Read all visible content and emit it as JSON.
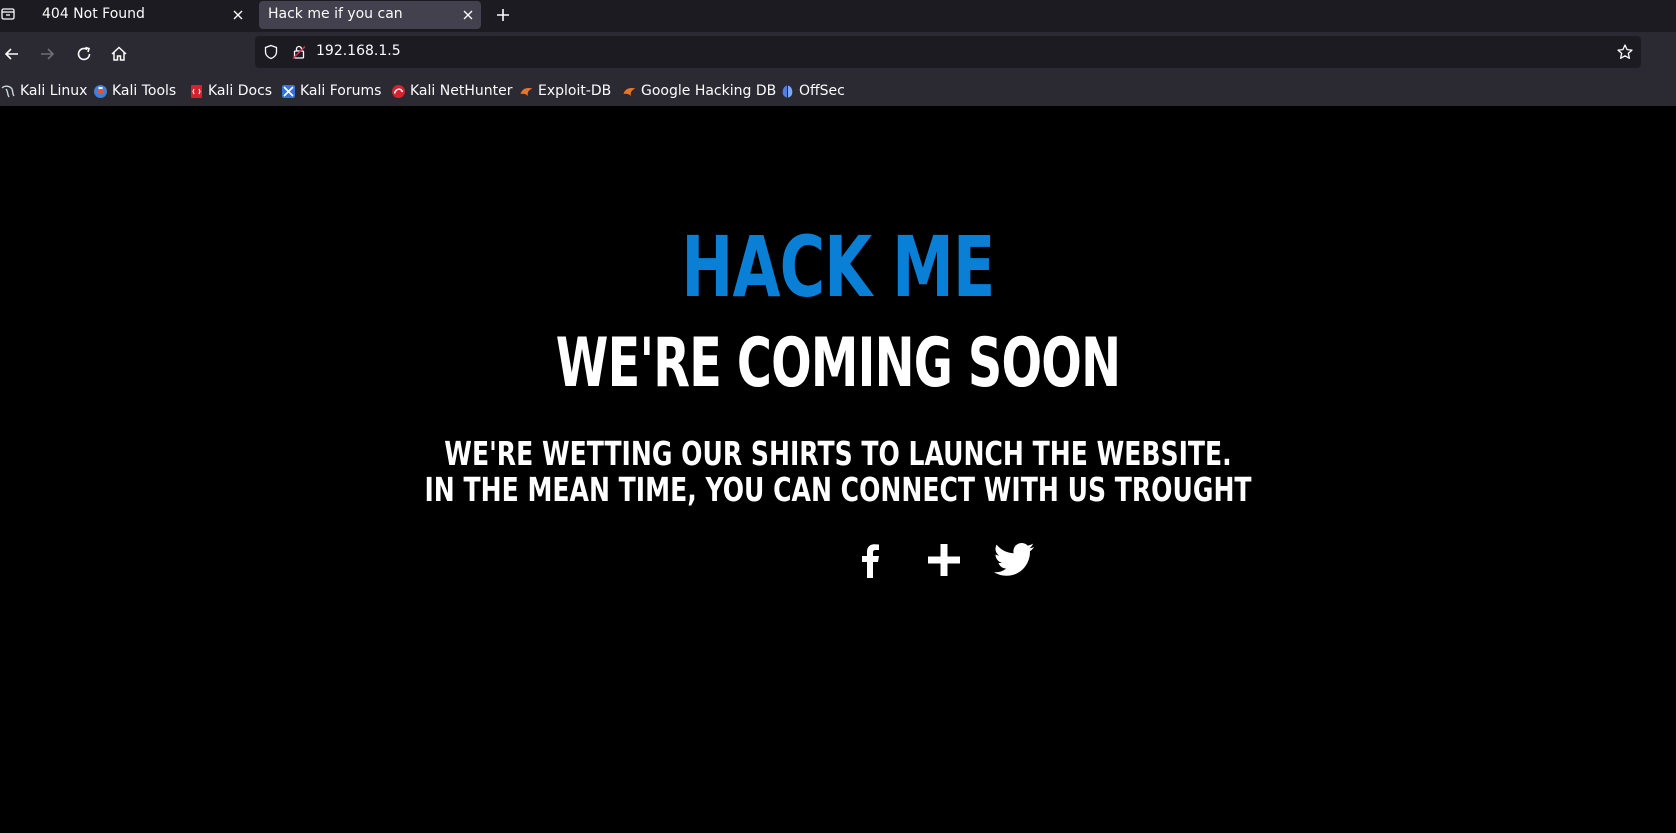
{
  "browser": {
    "tabs": [
      {
        "title": "404 Not Found",
        "active": false
      },
      {
        "title": "Hack me if you can",
        "active": true
      }
    ],
    "url": "192.168.1.5",
    "bookmarks": [
      {
        "label": "Kali Linux",
        "icon": "kali-dragon-icon"
      },
      {
        "label": "Kali Tools",
        "icon": "kali-tools-icon"
      },
      {
        "label": "Kali Docs",
        "icon": "kali-docs-icon"
      },
      {
        "label": "Kali Forums",
        "icon": "kali-forums-icon"
      },
      {
        "label": "Kali NetHunter",
        "icon": "nethunter-icon"
      },
      {
        "label": "Exploit-DB",
        "icon": "exploit-db-icon"
      },
      {
        "label": "Google Hacking DB",
        "icon": "ghdb-icon"
      },
      {
        "label": "OffSec",
        "icon": "offsec-icon"
      }
    ]
  },
  "page": {
    "headline": "HACK ME",
    "subheadline": "WE'RE COMING SOON",
    "message_line1": "WE'RE WETTING OUR SHIRTS TO LAUNCH THE WEBSITE.",
    "message_line2": "IN THE MEAN TIME, YOU CAN CONNECT WITH US TROUGHT",
    "social": [
      "facebook-icon",
      "google-plus-icon",
      "twitter-icon"
    ]
  },
  "colors": {
    "accent": "#0a7fd6",
    "page_bg": "#000000",
    "text": "#ffffff",
    "chrome_dark": "#1c1b22",
    "chrome": "#2b2a33"
  }
}
